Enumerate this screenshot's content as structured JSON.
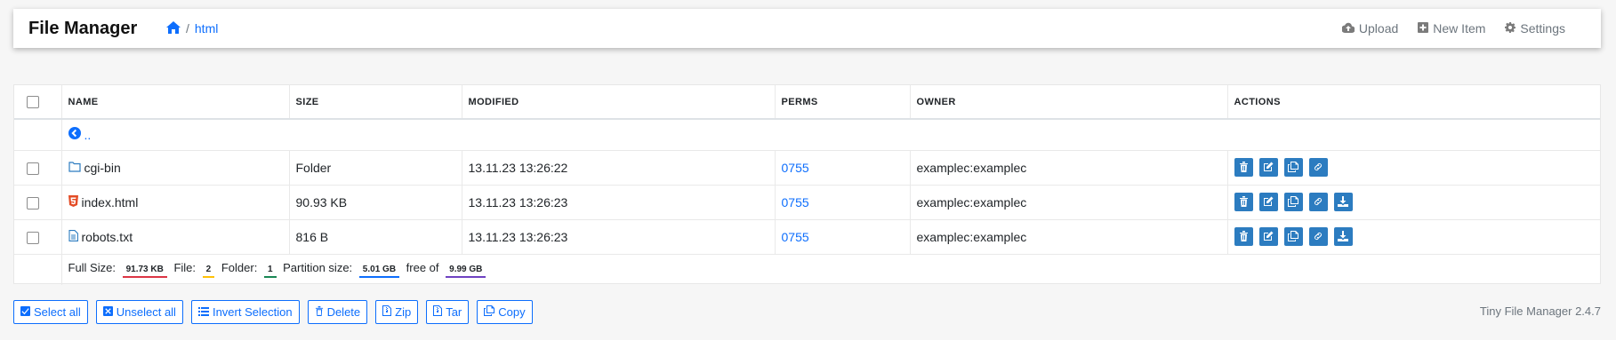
{
  "brand": "File Manager",
  "breadcrumb": {
    "separator": "/",
    "current": "html"
  },
  "nav": {
    "upload": "Upload",
    "new_item": "New Item",
    "settings": "Settings"
  },
  "table": {
    "headers": {
      "name": "NAME",
      "size": "SIZE",
      "modified": "MODIFIED",
      "perms": "PERMS",
      "owner": "OWNER",
      "actions": "ACTIONS"
    },
    "parent_label": "..",
    "rows": [
      {
        "name": "cgi-bin",
        "icon": "folder-icon",
        "size": "Folder",
        "modified": "13.11.23 13:26:22",
        "perms": "0755",
        "owner": "examplec:examplec",
        "download": false
      },
      {
        "name": "index.html",
        "icon": "html5-icon",
        "size": "90.93 KB",
        "modified": "13.11.23 13:26:23",
        "perms": "0755",
        "owner": "examplec:examplec",
        "download": true
      },
      {
        "name": "robots.txt",
        "icon": "text-file-icon",
        "size": "816 B",
        "modified": "13.11.23 13:26:23",
        "perms": "0755",
        "owner": "examplec:examplec",
        "download": true
      }
    ],
    "footer": {
      "full_size_label": "Full Size:",
      "full_size": "91.73 KB",
      "file_label": "File:",
      "file_count": "2",
      "folder_label": "Folder:",
      "folder_count": "1",
      "partition_label": "Partition size:",
      "partition_size": "5.01 GB",
      "free_label": "free of",
      "free_total": "9.99 GB"
    }
  },
  "buttons": {
    "select_all": "Select all",
    "unselect_all": "Unselect all",
    "invert": "Invert Selection",
    "delete": "Delete",
    "zip": "Zip",
    "tar": "Tar",
    "copy": "Copy"
  },
  "version": "Tiny File Manager 2.4.7",
  "colors": {
    "accent": "#0d6efd",
    "action_button": "#2c7cc0",
    "badge_full_size": "#dc3545",
    "badge_file": "#ffc107",
    "badge_folder": "#198754",
    "badge_partition": "#0d6efd",
    "badge_free": "#6f42c1"
  }
}
